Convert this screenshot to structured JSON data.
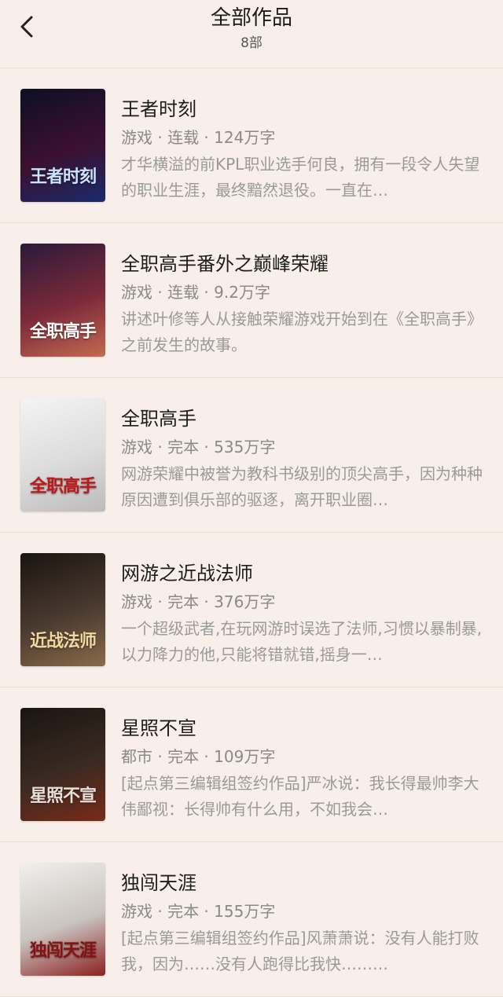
{
  "header": {
    "title": "全部作品",
    "subtitle": "8部"
  },
  "books": [
    {
      "title": "王者时刻",
      "meta": "游戏 · 连载 · 124万字",
      "desc": "才华横溢的前KPL职业选手何良，拥有一段令人失望的职业生涯，最终黯然退役。一直在…",
      "cover_text": "王者时刻",
      "cover_colors": [
        "#0d0f25",
        "#3b1030",
        "#1a2a6a"
      ],
      "cover_text_color": "#c9e4ff"
    },
    {
      "title": "全职高手番外之巅峰荣耀",
      "meta": "游戏 · 连载 · 9.2万字",
      "desc": "讲述叶修等人从接触荣耀游戏开始到在《全职高手》之前发生的故事。",
      "cover_text": "全职高手",
      "cover_colors": [
        "#2a1a3a",
        "#7b2a3a",
        "#c46a50"
      ],
      "cover_text_color": "#ffffff"
    },
    {
      "title": "全职高手",
      "meta": "游戏 · 完本 · 535万字",
      "desc": "网游荣耀中被誉为教科书级别的顶尖高手，因为种种原因遭到俱乐部的驱逐，离开职业圈…",
      "cover_text": "全职高手",
      "cover_colors": [
        "#f4f4f4",
        "#dcdcdc",
        "#bbbbbb"
      ],
      "cover_text_color": "#c01818"
    },
    {
      "title": "网游之近战法师",
      "meta": "游戏 · 完本 · 376万字",
      "desc": "一个超级武者,在玩网游时误选了法师,习惯以暴制暴,以力降力的他,只能将错就错,摇身一…",
      "cover_text": "近战法师",
      "cover_colors": [
        "#1a1410",
        "#4a3a30",
        "#8a6a4a"
      ],
      "cover_text_color": "#f0d8a0"
    },
    {
      "title": "星照不宣",
      "meta": "都市 · 完本 · 109万字",
      "desc": "[起点第三编辑组签约作品]严冰说：我长得最帅李大伟鄙视：长得帅有什么用，不如我会…",
      "cover_text": "星照不宣",
      "cover_colors": [
        "#1a1512",
        "#3a2a22",
        "#7a2a18"
      ],
      "cover_text_color": "#e8e0d8"
    },
    {
      "title": "独闯天涯",
      "meta": "游戏 · 完本 · 155万字",
      "desc": "[起点第三编辑组签约作品]风萧萧说：没有人能打败我，因为……没有人跑得比我快………",
      "cover_text": "独闯天涯",
      "cover_colors": [
        "#f2efec",
        "#c9c4c0",
        "#8a2020"
      ],
      "cover_text_color": "#8a1010"
    }
  ]
}
